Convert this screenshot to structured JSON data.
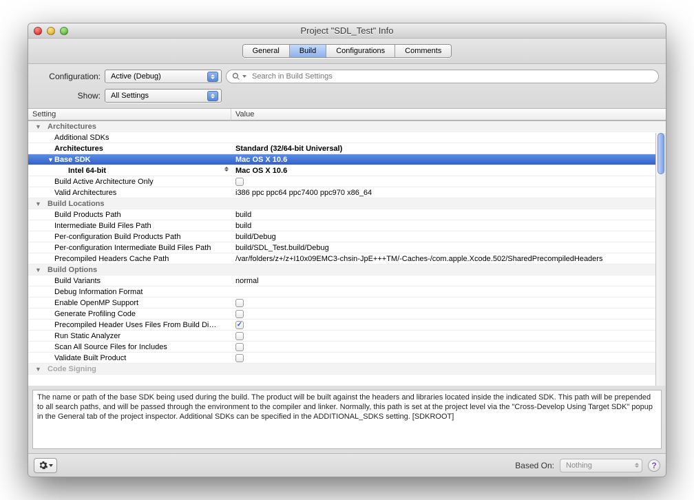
{
  "title": "Project \"SDL_Test\" Info",
  "tabs": [
    "General",
    "Build",
    "Configurations",
    "Comments"
  ],
  "activeTab": 1,
  "filters": {
    "configLabel": "Configuration:",
    "configValue": "Active (Debug)",
    "showLabel": "Show:",
    "showValue": "All Settings",
    "searchPlaceholder": "Search in Build Settings"
  },
  "columns": {
    "setting": "Setting",
    "value": "Value"
  },
  "rows": [
    {
      "type": "group",
      "label": "Architectures"
    },
    {
      "type": "item",
      "indent": 1,
      "label": "Additional SDKs",
      "value": ""
    },
    {
      "type": "item",
      "indent": 1,
      "label": "Architectures",
      "value": "Standard (32/64-bit Universal)",
      "arrows": true,
      "bold": true
    },
    {
      "type": "item",
      "indent": 1,
      "label": "Base SDK",
      "value": "Mac OS X 10.6",
      "selected": true,
      "disc": true,
      "bold": true,
      "arrows": true
    },
    {
      "type": "item",
      "indent": 2,
      "label": "Intel 64-bit",
      "value": "Mac OS X 10.6",
      "bold": true,
      "arrows": true
    },
    {
      "type": "item",
      "indent": 1,
      "label": "Build Active Architecture Only",
      "value": "",
      "checkbox": true,
      "checked": false
    },
    {
      "type": "item",
      "indent": 1,
      "label": "Valid Architectures",
      "value": "i386 ppc ppc64 ppc7400 ppc970 x86_64"
    },
    {
      "type": "group",
      "label": "Build Locations"
    },
    {
      "type": "item",
      "indent": 1,
      "label": "Build Products Path",
      "value": "build"
    },
    {
      "type": "item",
      "indent": 1,
      "label": "Intermediate Build Files Path",
      "value": "build"
    },
    {
      "type": "item",
      "indent": 1,
      "label": "Per-configuration Build Products Path",
      "value": "build/Debug"
    },
    {
      "type": "item",
      "indent": 1,
      "label": "Per-configuration Intermediate Build Files Path",
      "value": "build/SDL_Test.build/Debug"
    },
    {
      "type": "item",
      "indent": 1,
      "label": "Precompiled Headers Cache Path",
      "value": "/var/folders/z+/z+I10x09EMC3-chsin-JpE+++TM/-Caches-/com.apple.Xcode.502/SharedPrecompiledHeaders"
    },
    {
      "type": "group",
      "label": "Build Options"
    },
    {
      "type": "item",
      "indent": 1,
      "label": "Build Variants",
      "value": "normal"
    },
    {
      "type": "item",
      "indent": 1,
      "label": "Debug Information Format",
      "value": "",
      "arrows": true
    },
    {
      "type": "item",
      "indent": 1,
      "label": "Enable OpenMP Support",
      "value": "",
      "checkbox": true,
      "checked": false
    },
    {
      "type": "item",
      "indent": 1,
      "label": "Generate Profiling Code",
      "value": "",
      "checkbox": true,
      "checked": false
    },
    {
      "type": "item",
      "indent": 1,
      "label": "Precompiled Header Uses Files From Build Di…",
      "value": "",
      "checkbox": true,
      "checked": true
    },
    {
      "type": "item",
      "indent": 1,
      "label": "Run Static Analyzer",
      "value": "",
      "checkbox": true,
      "checked": false
    },
    {
      "type": "item",
      "indent": 1,
      "label": "Scan All Source Files for Includes",
      "value": "",
      "checkbox": true,
      "checked": false
    },
    {
      "type": "item",
      "indent": 1,
      "label": "Validate Built Product",
      "value": "",
      "checkbox": true,
      "checked": false
    },
    {
      "type": "group",
      "label": "Code Signing",
      "faded": true
    }
  ],
  "info": "The name or path of the base SDK being used during the build. The product will be built against the headers and libraries located inside the indicated SDK. This path will be prepended to all search paths, and will be passed through the environment to the compiler and linker. Normally, this path is set at the project level via the \"Cross-Develop Using Target SDK\" popup in the General tab of the project inspector. Additional SDKs can be specified in the ADDITIONAL_SDKS setting. [SDKROOT]",
  "footer": {
    "basedLabel": "Based On:",
    "basedValue": "Nothing"
  }
}
